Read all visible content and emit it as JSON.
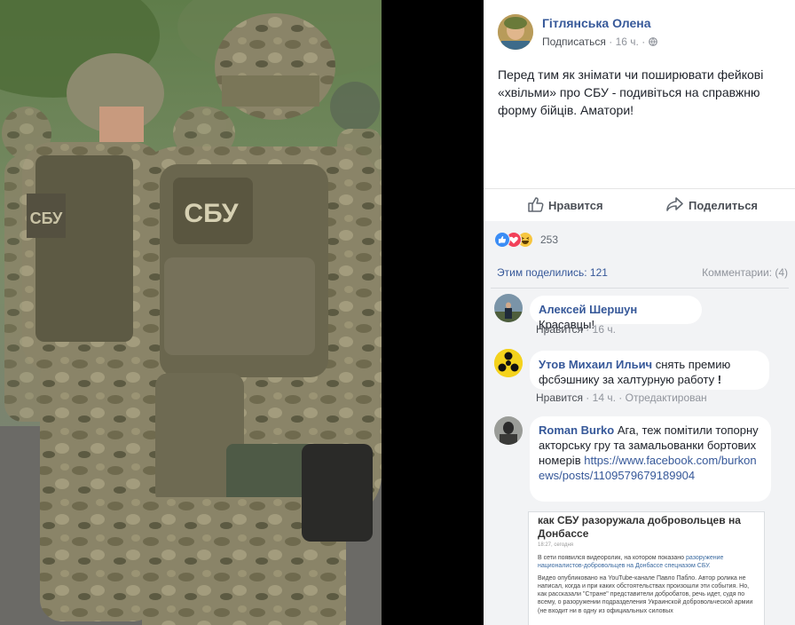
{
  "photo": {
    "patch_text": "СБУ"
  },
  "post": {
    "author": "Гітлянська Олена",
    "subscribe": "Подписаться",
    "time": "16 ч.",
    "dot": "·",
    "text": "Перед тим як знімати чи поширювати фейкові «хвільми» про СБУ - подивіться на справжню форму бійців. Аматори!"
  },
  "actions": {
    "like": "Нравится",
    "share": "Поделиться"
  },
  "reactions": {
    "count": "253",
    "types": [
      "like-icon",
      "love-icon",
      "haha-icon"
    ]
  },
  "stats": {
    "shares": "Этим поделились: 121",
    "comments": "Комментарии: (4)"
  },
  "comments": [
    {
      "name": "Алексей Шершун",
      "text": "Красавцы!",
      "like": "Нравится",
      "dot": "·",
      "time": "16 ч."
    },
    {
      "name": "Утов Михаил Ильич",
      "text": "снять премию фсбэшнику за халтурную работу",
      "excl": "!",
      "like": "Нравится",
      "dot": "·",
      "time": "14 ч.",
      "dot2": "·",
      "edited": "Отредактирован"
    },
    {
      "name": "Roman Burko",
      "text": "Ага, теж помітили топорну акторську гру та замальованки бортових номерів",
      "link": "https://www.facebook.com/burkonews/posts/1109579679189904"
    }
  ],
  "preview": {
    "title": "как СБУ разоружала добровольцев на Донбассе",
    "date": "18:27, сегодня",
    "p1_a": "В сети появился видеоролик, на котором показано ",
    "p1_b": "разоружение националистов-добровольцев на Донбассе спецназом СБУ.",
    "p2": "Видео опубликовано на YouTube-канале Павло Пабло. Автор ролика не написал, когда и при каких обстоятельствах произошли эти события. Но, как рассказали \"Стране\" представители добробатов, речь идет, судя по всему, о разоружении подразделения Украинской добровольческой армии (не входит ни в одну из официальных силовых"
  },
  "colors": {
    "link": "#365899",
    "muted": "#90949c",
    "bg_gray": "#f2f3f5"
  }
}
